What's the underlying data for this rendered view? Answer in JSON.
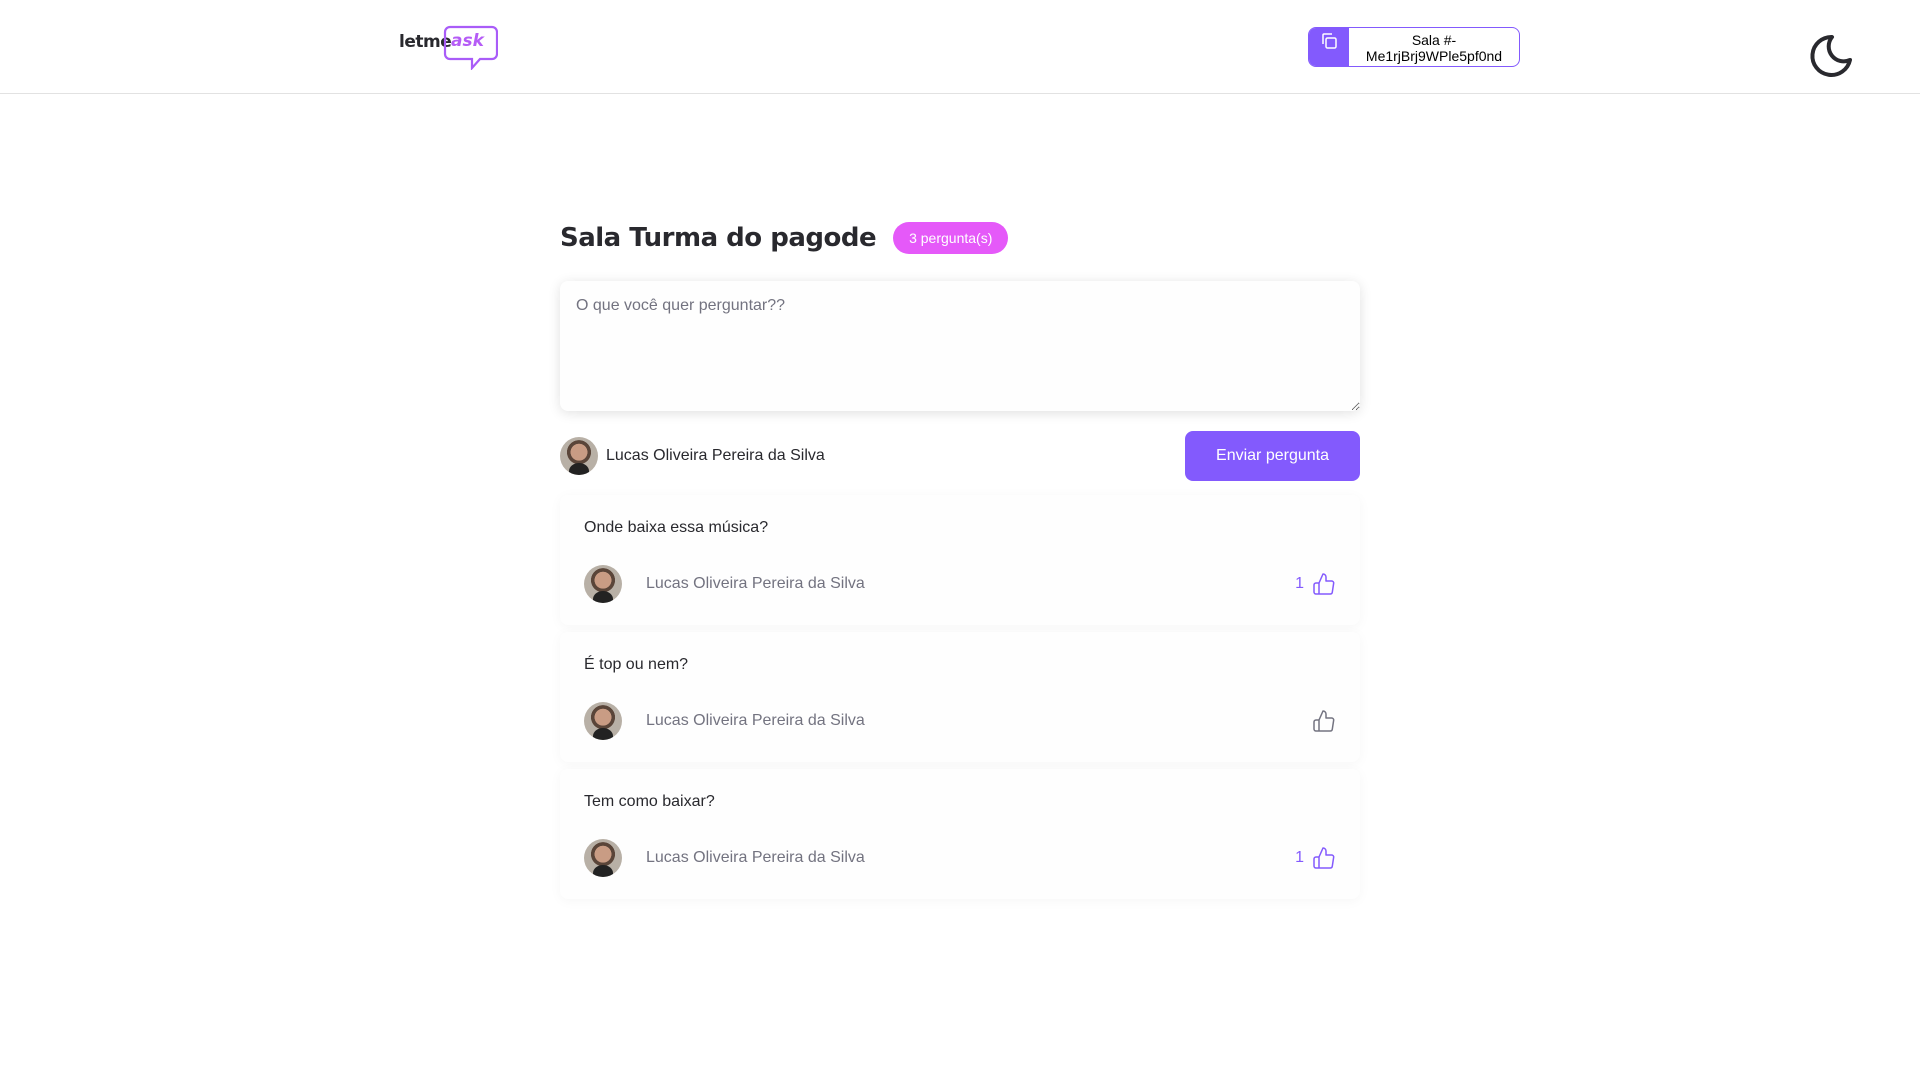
{
  "header": {
    "logo": {
      "primary": "letme",
      "accent": "ask"
    },
    "room_code_label": "Sala #-Me1rjBrj9WPle5pf0nd",
    "theme_icon": "moon-icon"
  },
  "room": {
    "title": "Sala Turma do pagode",
    "badge": "3 pergunta(s)"
  },
  "form": {
    "placeholder": "O que você quer perguntar??",
    "user_name": "Lucas Oliveira Pereira da Silva",
    "submit_label": "Enviar pergunta"
  },
  "questions": [
    {
      "content": "Onde baixa essa música?",
      "author": "Lucas Oliveira Pereira da Silva",
      "likes": "1",
      "liked": true
    },
    {
      "content": "É top ou nem?",
      "author": "Lucas Oliveira Pereira da Silva",
      "likes": "",
      "liked": false
    },
    {
      "content": "Tem como baixar?",
      "author": "Lucas Oliveira Pereira da Silva",
      "likes": "1",
      "liked": true
    }
  ],
  "colors": {
    "primary": "#835afd",
    "badge": "#e559f9",
    "muted_icon": "#737380"
  }
}
